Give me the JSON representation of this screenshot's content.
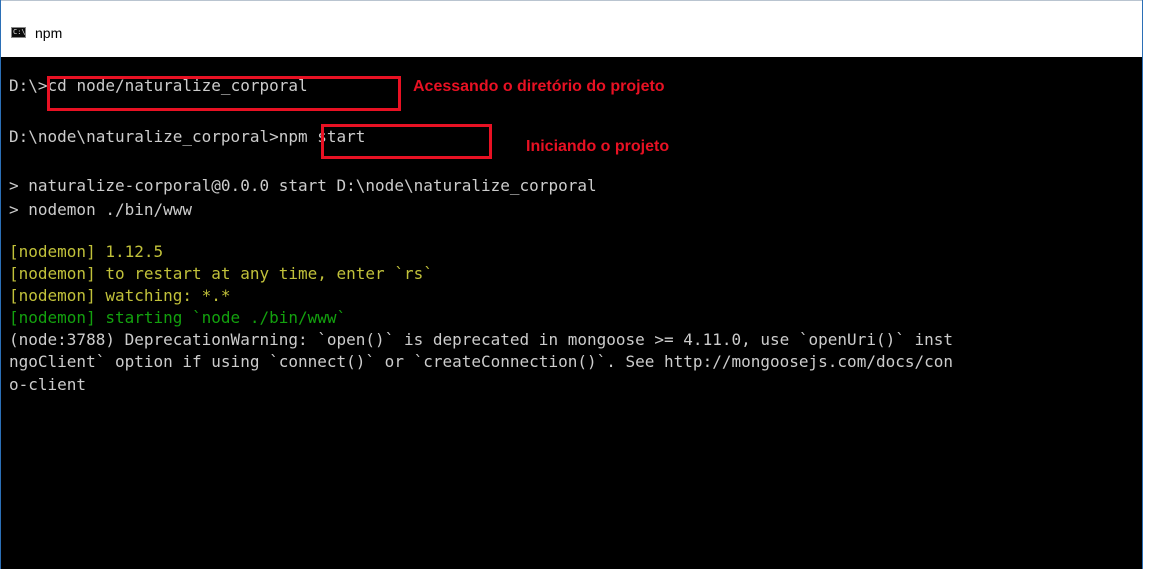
{
  "window": {
    "title": "npm",
    "icon": "cmd-console-icon",
    "icon_text": "C:\\."
  },
  "console": {
    "line1": {
      "prompt": "D:\\",
      "command": ">cd node/naturalize_corporal"
    },
    "line2": {
      "prompt": "D:\\node\\naturalize_corporal",
      "command": ">npm start"
    },
    "line3": "> naturalize-corporal@0.0.0 start D:\\node\\naturalize_corporal",
    "line4": "> nodemon ./bin/www",
    "line5": "[nodemon] 1.12.5",
    "line6": "[nodemon] to restart at any time, enter `rs`",
    "line7": "[nodemon] watching: *.*",
    "line8": "[nodemon] starting `node ./bin/www`",
    "line9": "(node:3788) DeprecationWarning: `open()` is deprecated in mongoose >= 4.11.0, use `openUri()` inst",
    "line10": "ngoClient` option if using `connect()` or `createConnection()`. See http://mongoosejs.com/docs/con",
    "line11": "o-client"
  },
  "annotations": {
    "first": "Acessando  o diretório do projeto",
    "second": "Iniciando o projeto"
  },
  "colors": {
    "background": "#000000",
    "text": "#cccccc",
    "nodemon_yellow": "#c1c13a",
    "nodemon_green": "#13a10e",
    "annotation_red": "#e81123"
  }
}
